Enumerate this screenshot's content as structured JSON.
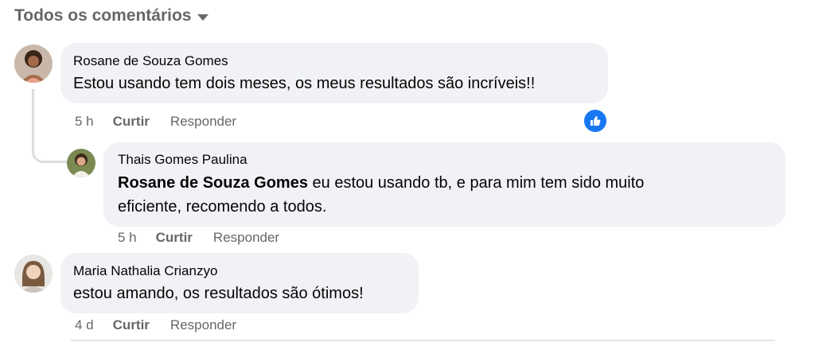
{
  "filter": {
    "label": "Todos os comentários"
  },
  "comments": [
    {
      "author": "Rosane de Souza Gomes",
      "text": "Estou usando tem dois meses, os meus resultados são incríveis!!",
      "time": "5 h",
      "like": "Curtir",
      "reply": "Responder",
      "reaction": "like-icon"
    },
    {
      "author": "Thais Gomes Paulina",
      "mention": "Rosane de Souza Gomes",
      "text_line1": " eu estou usando tb, e para mim tem sido muito",
      "text_line2": "eficiente, recomendo a todos.",
      "time": "5 h",
      "like": "Curtir",
      "reply": "Responder"
    },
    {
      "author": "Maria Nathalia Crianzyo",
      "text": "estou amando, os resultados são ótimos!",
      "time": "4 d",
      "like": "Curtir",
      "reply": "Responder"
    }
  ],
  "colors": {
    "bubble": "#f0f2f5",
    "meta": "#65676b",
    "accent": "#1877f2",
    "thread": "#dadde1"
  }
}
